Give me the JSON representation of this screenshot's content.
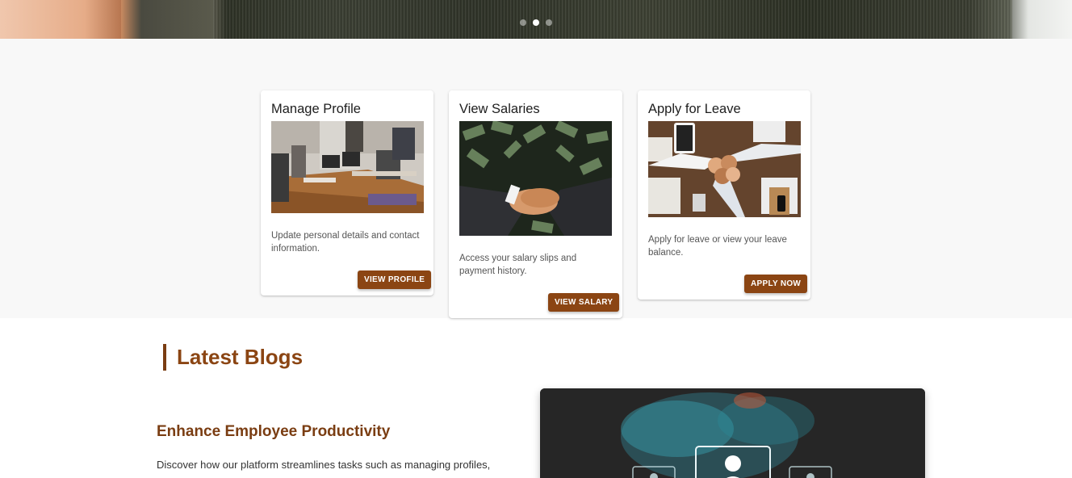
{
  "hero": {
    "slides": [
      {
        "label": "slide-1",
        "active": false
      },
      {
        "label": "slide-2",
        "active": true
      },
      {
        "label": "slide-3",
        "active": false
      }
    ]
  },
  "services": [
    {
      "title": "Manage Profile",
      "description": "Update personal details and contact information.",
      "button": "VIEW PROFILE",
      "image": "team-meeting-laptops"
    },
    {
      "title": "View Salaries",
      "description": "Access your salary slips and payment history.",
      "button": "VIEW SALARY",
      "image": "handshake-money"
    },
    {
      "title": "Apply for Leave",
      "description": "Apply for leave or view your leave balance.",
      "button": "APPLY NOW",
      "image": "fist-bump-desk"
    }
  ],
  "blogs": {
    "heading": "Latest Blogs",
    "post": {
      "title": "Enhance Employee Productivity",
      "excerpt": "Discover how our platform streamlines tasks such as managing profiles,",
      "image": "network-people-icons"
    }
  },
  "colors": {
    "accent": "#8b4513",
    "heading": "#7a3d12",
    "band_bg": "#f8f8f8"
  }
}
